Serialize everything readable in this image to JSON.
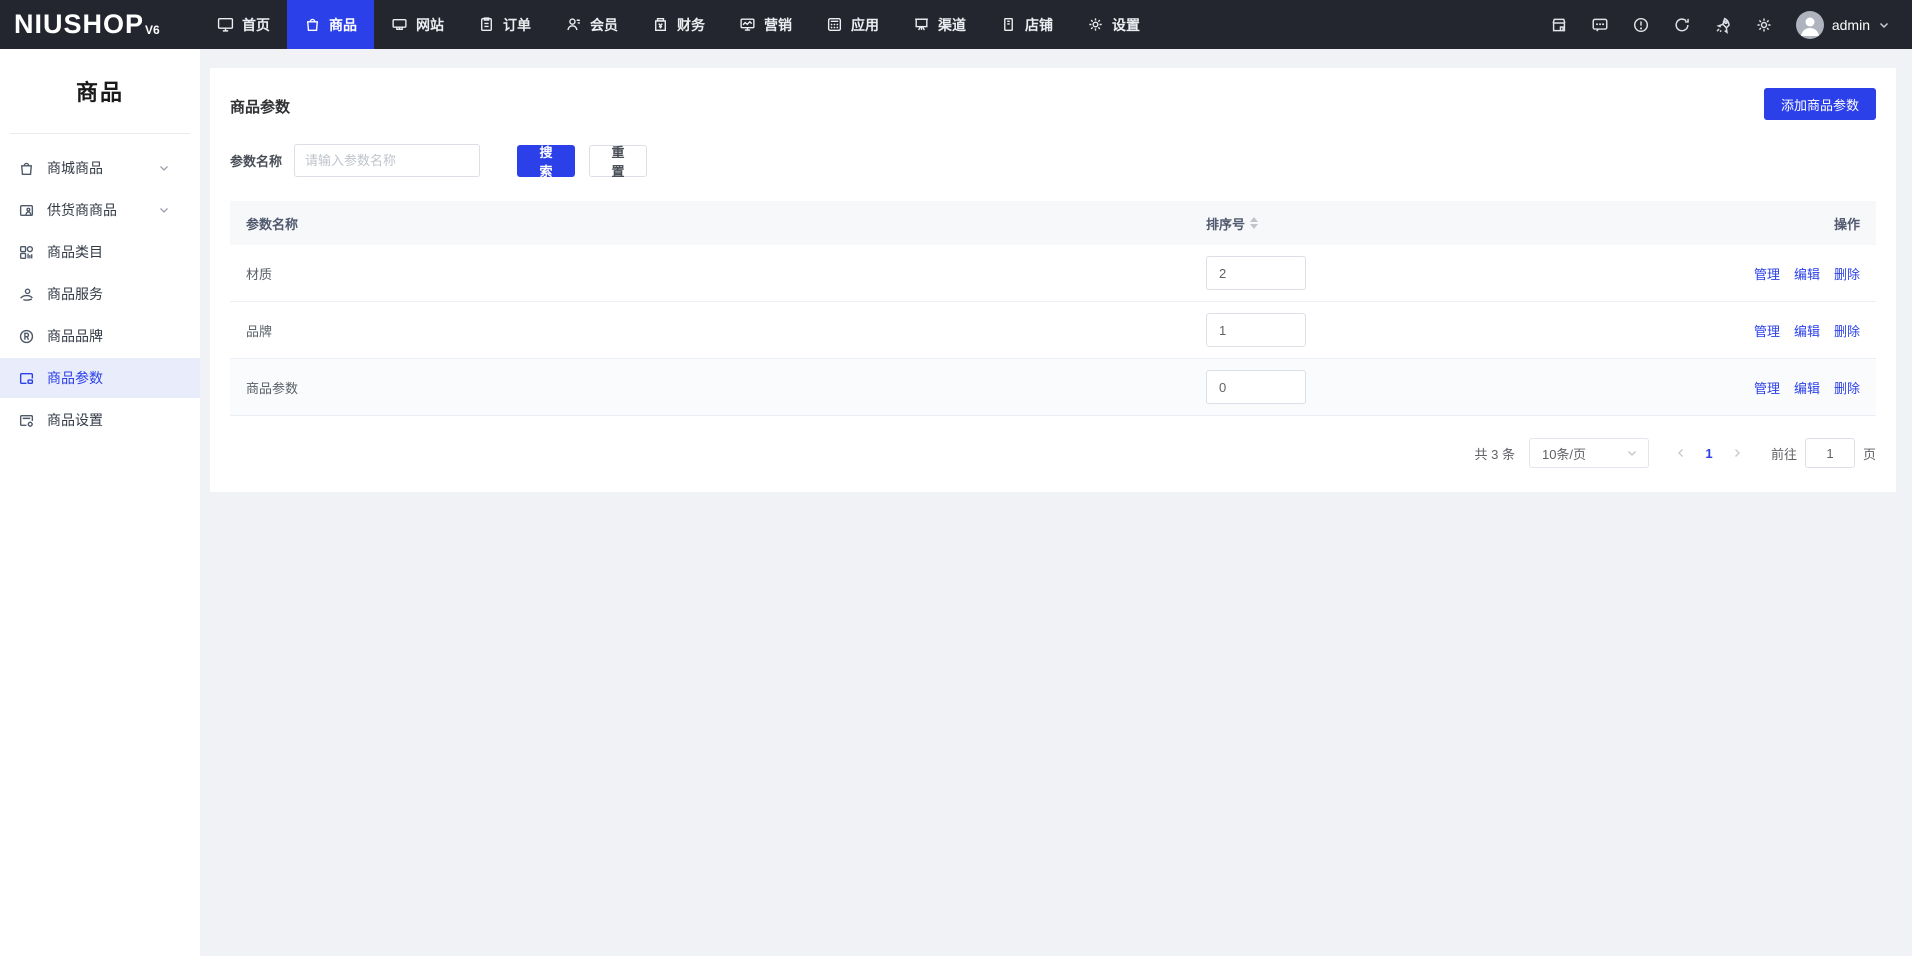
{
  "colors": {
    "primary": "#2b40e8",
    "navbar_bg": "#23262e",
    "page_bg": "#f0f2f5",
    "sidebar_active_bg": "#e9ecfb",
    "table_header_bg": "#f7f8fa"
  },
  "navbar": {
    "logo_text": "NIUSHOP",
    "logo_version": "V6",
    "items": [
      {
        "label": "首页",
        "icon": "monitor-icon",
        "active": false
      },
      {
        "label": "商品",
        "icon": "goods-bag-icon",
        "active": true
      },
      {
        "label": "网站",
        "icon": "website-icon",
        "active": false
      },
      {
        "label": "订单",
        "icon": "order-clipboard-icon",
        "active": false
      },
      {
        "label": "会员",
        "icon": "member-icon",
        "active": false
      },
      {
        "label": "财务",
        "icon": "finance-bag-icon",
        "active": false
      },
      {
        "label": "营销",
        "icon": "marketing-chart-icon",
        "active": false
      },
      {
        "label": "应用",
        "icon": "apps-calculator-icon",
        "active": false
      },
      {
        "label": "渠道",
        "icon": "channel-board-icon",
        "active": false
      },
      {
        "label": "店铺",
        "icon": "store-book-icon",
        "active": false
      },
      {
        "label": "设置",
        "icon": "settings-gear-icon",
        "active": false
      }
    ],
    "right_icons": [
      "storefront-icon",
      "message-icon",
      "info-icon",
      "refresh-icon",
      "rocket-icon",
      "gear-icon"
    ],
    "user": {
      "name": "admin"
    }
  },
  "sidebar": {
    "title": "商品",
    "items": [
      {
        "label": "商城商品",
        "icon": "mall-goods-icon",
        "expandable": true,
        "active": false
      },
      {
        "label": "供货商商品",
        "icon": "supplier-goods-icon",
        "expandable": true,
        "active": false
      },
      {
        "label": "商品类目",
        "icon": "category-grid-icon",
        "expandable": false,
        "active": false
      },
      {
        "label": "商品服务",
        "icon": "service-icon",
        "expandable": false,
        "active": false
      },
      {
        "label": "商品品牌",
        "icon": "brand-r-icon",
        "expandable": false,
        "active": false
      },
      {
        "label": "商品参数",
        "icon": "params-card-icon",
        "expandable": false,
        "active": true
      },
      {
        "label": "商品设置",
        "icon": "goods-settings-icon",
        "expandable": false,
        "active": false
      }
    ]
  },
  "main": {
    "page_title": "商品参数",
    "add_button_label": "添加商品参数",
    "search": {
      "label": "参数名称",
      "placeholder": "请输入参数名称",
      "search_button_label": "搜索",
      "reset_button_label": "重置"
    },
    "table": {
      "headers": {
        "name": "参数名称",
        "sort": "排序号",
        "actions": "操作"
      },
      "rows": [
        {
          "name": "材质",
          "sort": "2"
        },
        {
          "name": "品牌",
          "sort": "1"
        },
        {
          "name": "商品参数",
          "sort": "0"
        }
      ],
      "actions": {
        "manage": "管理",
        "edit": "编辑",
        "delete": "删除"
      }
    },
    "pagination": {
      "total_text": "共 3 条",
      "page_size_text": "10条/页",
      "current_page": "1",
      "goto_label": "前往",
      "goto_value": "1",
      "goto_suffix": "页"
    }
  }
}
